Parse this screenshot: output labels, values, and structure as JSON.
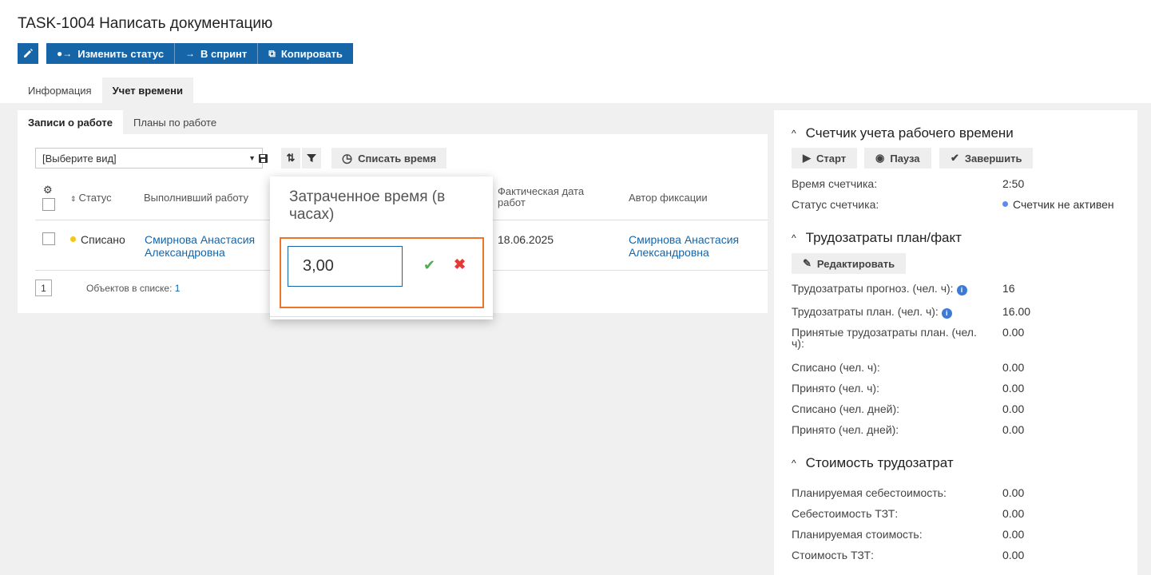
{
  "header": {
    "title": "TASK-1004 Написать документацию",
    "actions": [
      {
        "label": "Изменить статус",
        "icon": "status-icon"
      },
      {
        "label": "В спринт",
        "icon": "arrow-right-icon"
      },
      {
        "label": "Копировать",
        "icon": "copy-icon"
      }
    ],
    "edit_icon": "pencil-icon"
  },
  "tabs": [
    "Информация",
    "Учет времени"
  ],
  "subtabs": [
    "Записи о работе",
    "Планы по работе"
  ],
  "toolbar": {
    "view_select": "[Выберите вид]",
    "writeoff_label": "Списать время"
  },
  "table": {
    "columns": [
      "Статус",
      "Выполнивший работу",
      "Фактическая дата работ",
      "Автор фиксации"
    ],
    "rows": [
      {
        "status": "Списано",
        "status_color": "#f5c518",
        "performer": "Смирнова Анастасия Александровна",
        "date": "18.06.2025",
        "author": "Смирнова Анастасия Александровна"
      }
    ],
    "page": "1",
    "count_label": "Объектов в списке:",
    "count": "1"
  },
  "popup": {
    "title": "Затраченное время (в часах)",
    "value": "3,00"
  },
  "timer": {
    "title": "Счетчик учета рабочего времени",
    "start": "Старт",
    "pause": "Пауза",
    "finish": "Завершить",
    "time_label": "Время счетчика:",
    "time_value": "2:50",
    "status_label": "Статус счетчика:",
    "status_value": "Счетчик не активен",
    "status_color": "#5b8def"
  },
  "effort": {
    "title": "Трудозатраты план/факт",
    "edit": "Редактировать",
    "rows": [
      {
        "label": "Трудозатраты прогноз. (чел. ч):",
        "value": "16"
      },
      {
        "label": "Трудозатраты план. (чел. ч):",
        "value": "16.00"
      },
      {
        "label": "Принятые трудозатраты план. (чел. ч):",
        "value": "0.00"
      },
      {
        "label": "Списано (чел. ч):",
        "value": "0.00"
      },
      {
        "label": "Принято (чел. ч):",
        "value": "0.00"
      },
      {
        "label": "Списано (чел. дней):",
        "value": "0.00"
      },
      {
        "label": "Принято (чел. дней):",
        "value": "0.00"
      }
    ]
  },
  "cost": {
    "title": "Стоимость трудозатрат",
    "rows": [
      {
        "label": "Планируемая себестоимость:",
        "value": "0.00"
      },
      {
        "label": "Себестоимость ТЗТ:",
        "value": "0.00"
      },
      {
        "label": "Планируемая стоимость:",
        "value": "0.00"
      },
      {
        "label": "Стоимость ТЗТ:",
        "value": "0.00"
      }
    ]
  },
  "colors": {
    "accent": "#1565a8",
    "highlight": "#f0732a"
  }
}
